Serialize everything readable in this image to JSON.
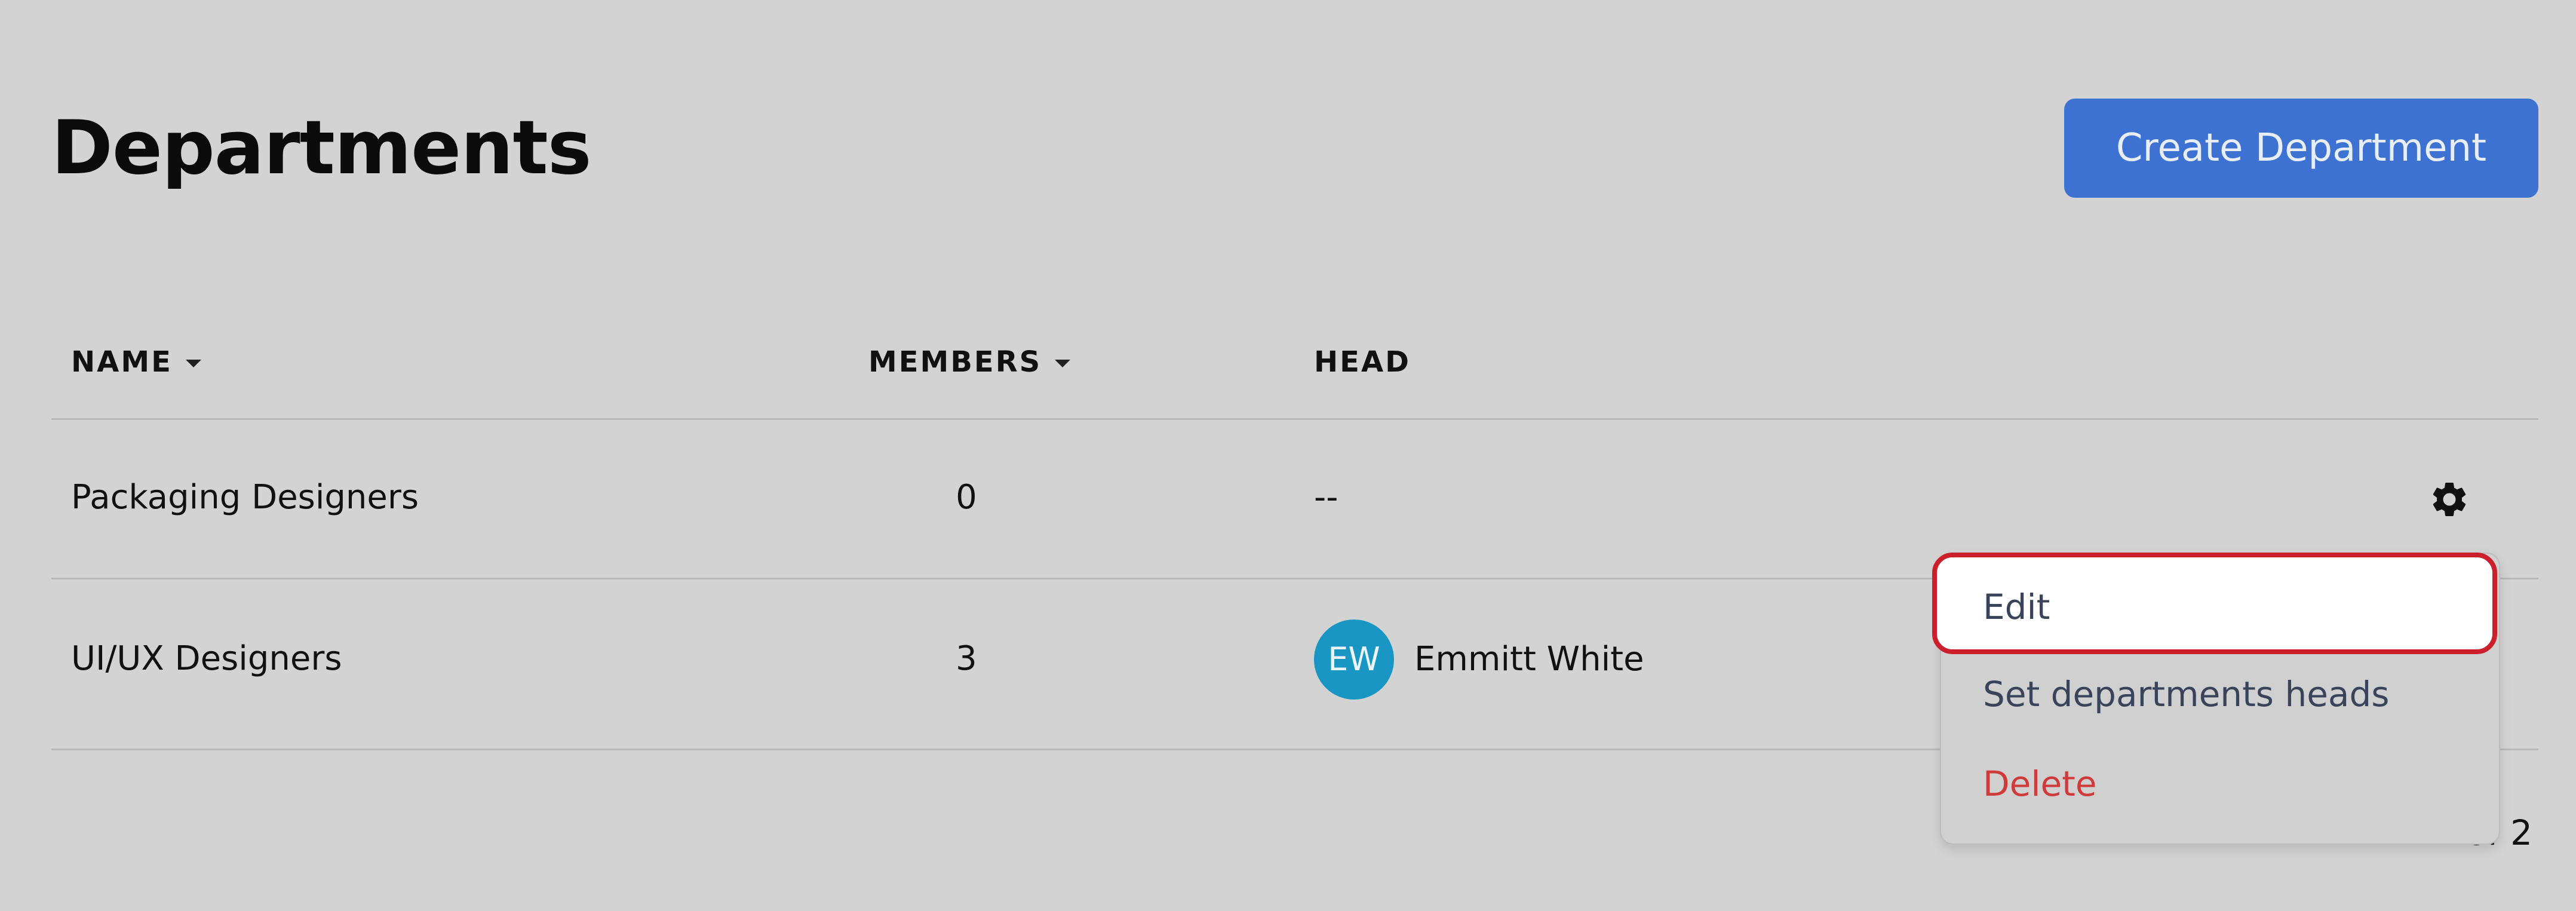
{
  "header": {
    "title": "Departments",
    "create_button_label": "Create Department"
  },
  "table": {
    "columns": [
      {
        "label": "NAME",
        "sortable": true
      },
      {
        "label": "MEMBERS",
        "sortable": true
      },
      {
        "label": "HEAD",
        "sortable": false
      }
    ],
    "rows": [
      {
        "name": "Packaging Designers",
        "members": "0",
        "head": "--"
      },
      {
        "name": "UI/UX Designers",
        "members": "3",
        "head": "Emmitt White",
        "head_initials": "EW"
      }
    ]
  },
  "context_menu": {
    "items": [
      "Edit",
      "Set departments heads",
      "Delete"
    ]
  },
  "pagination": {
    "text": "2 of 2"
  },
  "colors": {
    "accent": "#3d72d2",
    "avatar": "#1a96c4",
    "danger": "#cf3a3a",
    "highlight_border": "#cc1f2c"
  },
  "icons": [
    "gear-icon",
    "sort-caret-icon"
  ]
}
